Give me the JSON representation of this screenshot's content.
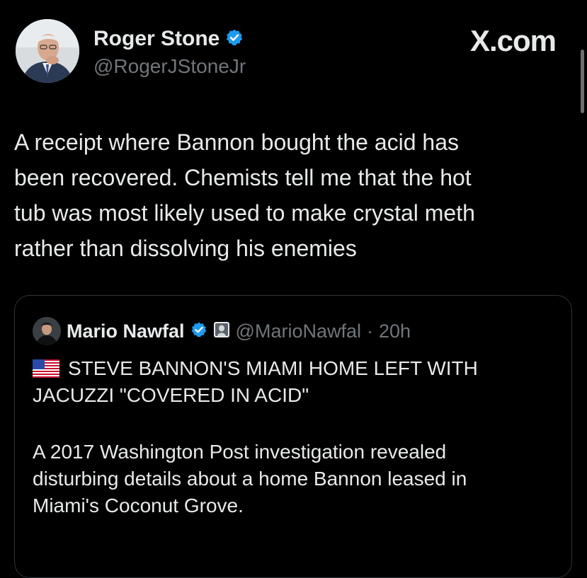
{
  "author": {
    "name": "Roger Stone",
    "handle": "@RogerJStoneJr",
    "verified_icon": "verified-badge-icon",
    "badge_color": "#1d9bf0"
  },
  "brand": "X.com",
  "tweet": {
    "lines": [
      "A receipt where Bannon bought the acid has",
      "been recovered. Chemists tell me that the hot",
      "tub was most likely used to make crystal meth",
      "rather than dissolving his enemies"
    ]
  },
  "quote": {
    "name": "Mario Nawfal",
    "handle": "@MarioNawfal",
    "separator": "·",
    "time": "20h",
    "flag_icon": "us-flag-icon",
    "headline_lines": [
      "STEVE BANNON'S MIAMI HOME LEFT WITH",
      "JACUZZI \"COVERED IN ACID\""
    ],
    "body_lines": [
      "A 2017 Washington Post investigation revealed",
      "disturbing details about a home Bannon leased in",
      "Miami's Coconut Grove."
    ]
  },
  "colors": {
    "background": "#000000",
    "text": "#e7e9ea",
    "muted": "#71767b",
    "border": "#2f3336"
  }
}
